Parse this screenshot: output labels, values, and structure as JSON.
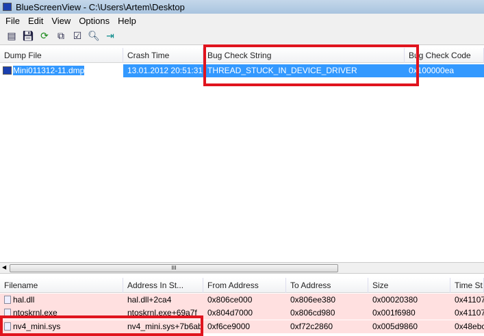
{
  "window": {
    "title": "BlueScreenView  -  C:\\Users\\Artem\\Desktop"
  },
  "menu": [
    "File",
    "Edit",
    "View",
    "Options",
    "Help"
  ],
  "toolbar": [
    "properties-icon",
    "save-icon",
    "refresh-icon",
    "copy-icon",
    "options-icon",
    "find-icon",
    "exit-icon"
  ],
  "top_table": {
    "headers": [
      "Dump File",
      "Crash Time",
      "Bug Check String",
      "Bug Check Code"
    ],
    "rows": [
      [
        "Mini011312-11.dmp",
        "13.01.2012 20:51:31",
        "THREAD_STUCK_IN_DEVICE_DRIVER",
        "0x100000ea"
      ]
    ]
  },
  "scrollbar": {
    "grip": "III"
  },
  "bottom_table": {
    "headers": [
      "Filename",
      "Address In St...",
      "From Address",
      "To Address",
      "Size",
      "Time St"
    ],
    "rows": [
      [
        "hal.dll",
        "hal.dll+2ca4",
        "0x806ce000",
        "0x806ee380",
        "0x00020380",
        "0x41107"
      ],
      [
        "ntoskrnl.exe",
        "ntoskrnl.exe+69a7f",
        "0x804d7000",
        "0x806cd980",
        "0x001f6980",
        "0x41107"
      ],
      [
        "nv4_mini.sys",
        "nv4_mini.sys+7b6ab",
        "0xf6ce9000",
        "0xf72c2860",
        "0x005d9860",
        "0x48ebc"
      ]
    ]
  },
  "colors": {
    "highlight": "#e0141e",
    "selection": "#3399ff",
    "row_pink": "#ffe0e0"
  }
}
